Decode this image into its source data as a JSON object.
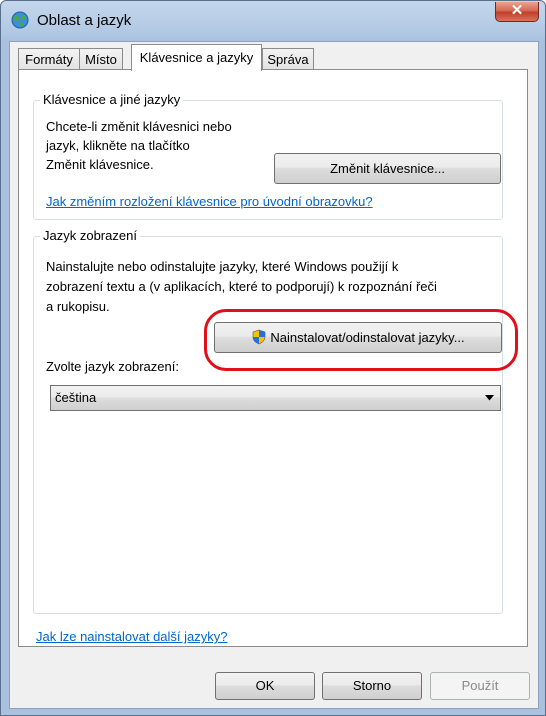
{
  "window": {
    "title": "Oblast a jazyk",
    "close_glyph": "✕"
  },
  "tabs": [
    {
      "label": "Formáty"
    },
    {
      "label": "Místo"
    },
    {
      "label": "Klávesnice a jazyky"
    },
    {
      "label": "Správa"
    }
  ],
  "keyboard_group": {
    "title": "Klávesnice a jiné jazyky",
    "description_lines": [
      "Chcete-li změnit klávesnici nebo",
      "jazyk, klikněte na tlačítko",
      "Změnit klávesnice."
    ],
    "change_button": "Změnit klávesnice...",
    "welcome_link": "Jak změním rozložení klávesnice pro úvodní obrazovku?"
  },
  "display_group": {
    "title": "Jazyk zobrazení",
    "description_lines": [
      "Nainstalujte nebo odinstalujte jazyky, které Windows použijí k",
      "zobrazení textu a (v aplikacích, které to podporují) k rozpoznání řeči",
      "a rukopisu."
    ],
    "install_button": "Nainstalovat/odinstalovat jazyky...",
    "choose_label": "Zvolte jazyk zobrazení:",
    "selected_language": "čeština"
  },
  "footer_link": "Jak lze nainstalovat další jazyky?",
  "buttons": {
    "ok": "OK",
    "cancel": "Storno",
    "apply": "Použít"
  },
  "icons": {
    "title": "globe-icon",
    "install": "uac-shield-icon",
    "dropdown": "dropdown-arrow-icon"
  },
  "colors": {
    "link": "#0066cc",
    "highlight": "#e0101a",
    "close": "#c0402a"
  }
}
